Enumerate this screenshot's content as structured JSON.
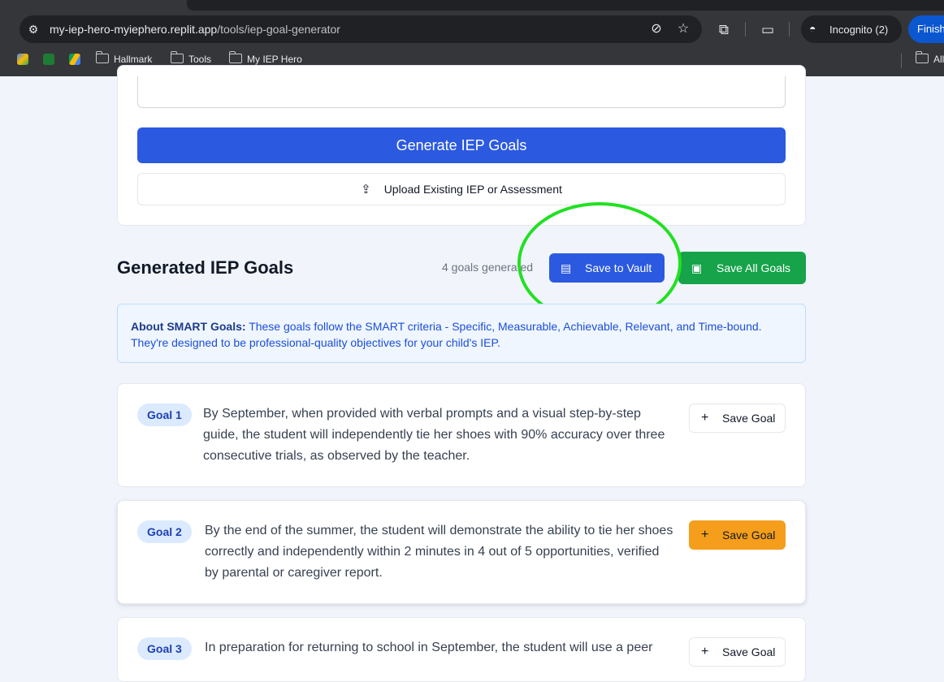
{
  "browser": {
    "url_host": "my-iep-hero-myiephero.replit.app",
    "url_path": "/tools/iep-goal-generator",
    "incognito_label": "Incognito (2)",
    "finish_label": "Finish",
    "bookmarks": [
      "Hallmark",
      "Tools",
      "My IEP Hero"
    ],
    "bookmarks_right": "All"
  },
  "form": {
    "generate_label": "Generate IEP Goals",
    "upload_label": "Upload Existing IEP or Assessment"
  },
  "results": {
    "title": "Generated IEP Goals",
    "count_text": "4 goals generated",
    "save_vault_label": "Save to Vault",
    "save_all_label": "Save All Goals"
  },
  "info": {
    "heading": "About SMART Goals:",
    "text": "These goals follow the SMART criteria - Specific, Measurable, Achievable, Relevant, and Time-bound. They're designed to be professional-quality objectives for your child's IEP."
  },
  "goals": [
    {
      "badge": "Goal 1",
      "text": "By September, when provided with verbal prompts and a visual step-by-step guide, the student will independently tie her shoes with 90% accuracy over three consecutive trials, as observed by the teacher.",
      "save_label": "Save Goal",
      "active": false
    },
    {
      "badge": "Goal 2",
      "text": "By the end of the summer, the student will demonstrate the ability to tie her shoes correctly and independently within 2 minutes in 4 out of 5 opportunities, verified by parental or caregiver report.",
      "save_label": "Save Goal",
      "active": true
    },
    {
      "badge": "Goal 3",
      "text": "In preparation for returning to school in September, the student will use a peer",
      "save_label": "Save Goal",
      "active": false
    }
  ],
  "colors": {
    "primary": "#2b59e0",
    "success": "#16a34a",
    "accent": "#f59e1b",
    "annotation": "#22e022"
  }
}
